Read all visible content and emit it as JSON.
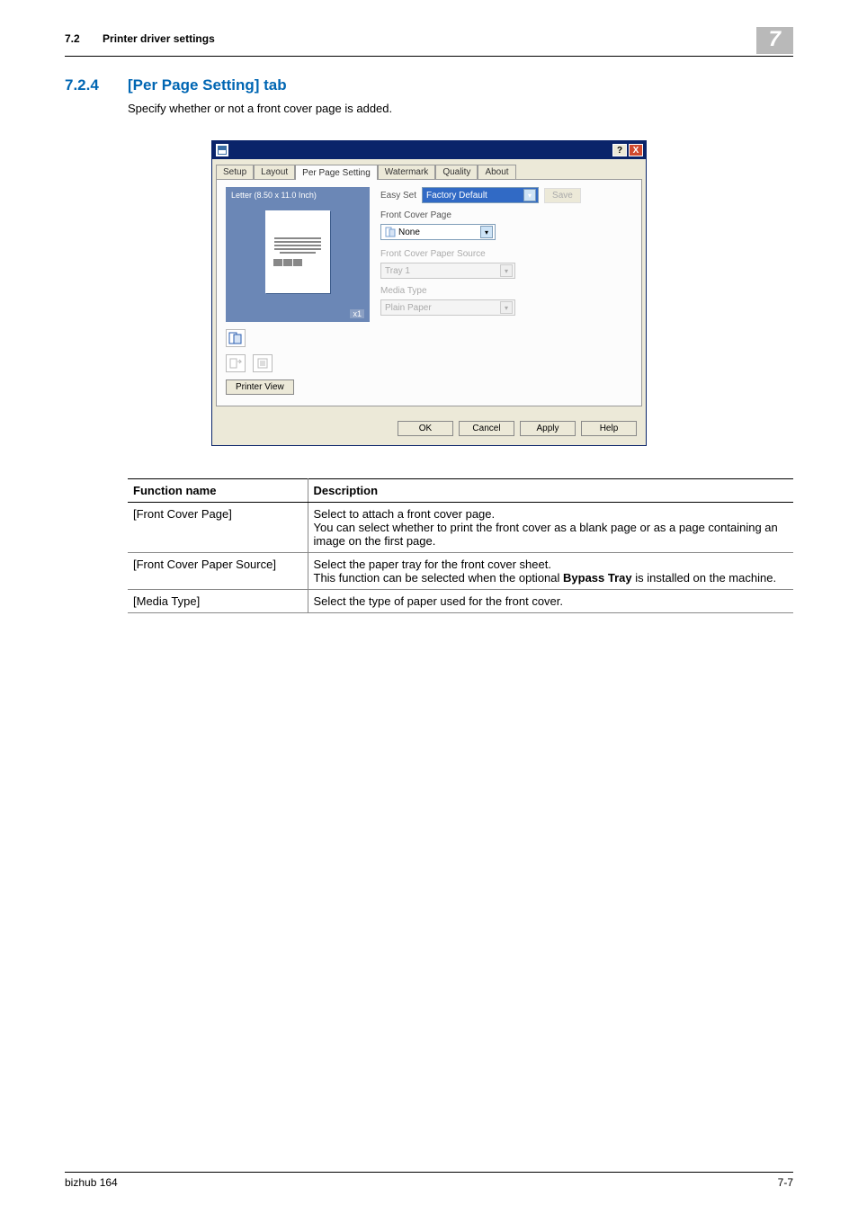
{
  "header": {
    "section_no": "7.2",
    "section_title": "Printer driver settings",
    "chapter_badge": "7"
  },
  "heading": {
    "number": "7.2.4",
    "title": "[Per Page Setting] tab"
  },
  "intro": "Specify whether or not a front cover page is added.",
  "dialog": {
    "tabs": [
      "Setup",
      "Layout",
      "Per Page Setting",
      "Watermark",
      "Quality",
      "About"
    ],
    "active_tab_index": 2,
    "preview_paper_label": "Letter (8.50 x 11.0 Inch)",
    "preview_count": "x1",
    "printer_view_btn": "Printer View",
    "easy_set": {
      "label": "Easy Set",
      "value": "Factory Default",
      "save": "Save"
    },
    "front_cover_page": {
      "label": "Front Cover Page",
      "value": "None"
    },
    "front_cover_paper_source": {
      "label": "Front Cover Paper Source",
      "value": "Tray 1"
    },
    "media_type": {
      "label": "Media Type",
      "value": "Plain Paper"
    },
    "buttons": {
      "ok": "OK",
      "cancel": "Cancel",
      "apply": "Apply",
      "help": "Help"
    },
    "help_q": "?",
    "close_x": "X"
  },
  "table": {
    "headers": {
      "name": "Function name",
      "desc": "Description"
    },
    "rows": [
      {
        "name": "[Front Cover Page]",
        "desc": "Select to attach a front cover page.\nYou can select whether to print the front cover as a blank page or as a page containing an image on the first page."
      },
      {
        "name": "[Front Cover Paper Source]",
        "desc_parts": [
          "Select the paper tray for the front cover sheet.\nThis function can be selected when the optional ",
          "Bypass Tray",
          " is installed on the machine."
        ]
      },
      {
        "name": "[Media Type]",
        "desc": "Select the type of paper used for the front cover."
      }
    ]
  },
  "footer": {
    "left": "bizhub 164",
    "right": "7-7"
  }
}
